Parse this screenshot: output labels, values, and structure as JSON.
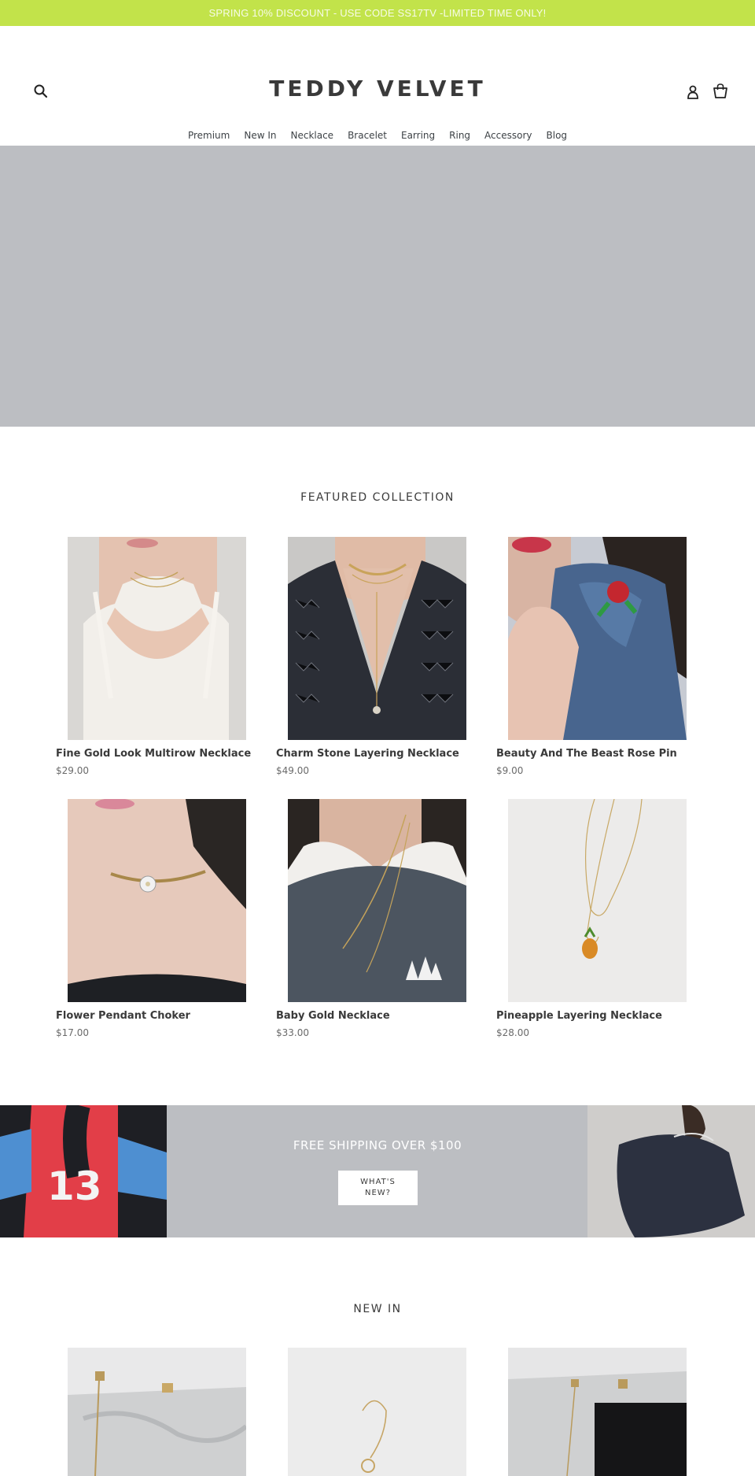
{
  "announcement": "SPRING 10% DISCOUNT - USE CODE SS17TV -LIMITED TIME ONLY!",
  "header": {
    "logo": "TEDDY VELVET"
  },
  "nav": [
    "Premium",
    "New In",
    "Necklace",
    "Bracelet",
    "Earring",
    "Ring",
    "Accessory",
    "Blog"
  ],
  "featured": {
    "title": "FEATURED COLLECTION",
    "products": [
      {
        "name": "Fine Gold Look Multirow Necklace",
        "price": "$29.00"
      },
      {
        "name": "Charm Stone Layering Necklace",
        "price": "$49.00"
      },
      {
        "name": "Beauty And The Beast Rose Pin",
        "price": "$9.00"
      },
      {
        "name": "Flower Pendant Choker",
        "price": "$17.00"
      },
      {
        "name": "Baby Gold Necklace",
        "price": "$33.00"
      },
      {
        "name": "Pineapple Layering Necklace",
        "price": "$28.00"
      }
    ]
  },
  "promo": {
    "title": "FREE SHIPPING OVER $100",
    "button_line1": "WHAT'S",
    "button_line2": "NEW?"
  },
  "new_in": {
    "title": "NEW IN"
  },
  "icons": {
    "search": "search-icon",
    "account": "account-icon",
    "cart": "cart-icon"
  },
  "colors": {
    "announcement_bg": "#c2e34a",
    "hero_bg": "#bcbec2"
  }
}
